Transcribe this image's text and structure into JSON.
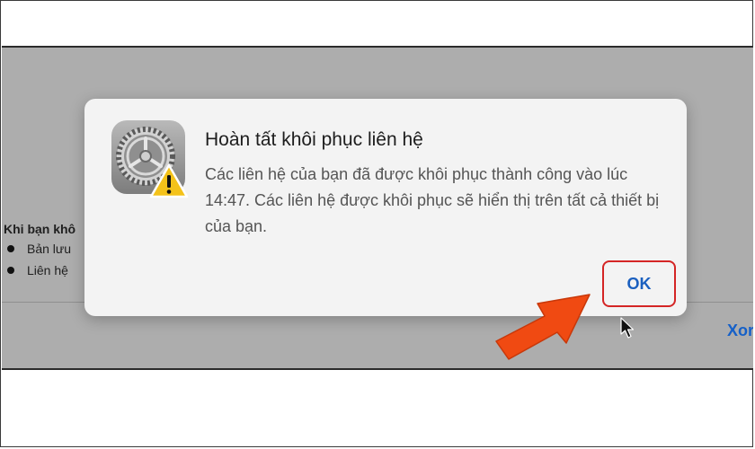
{
  "dialog": {
    "title": "Hoàn tất khôi phục liên hệ",
    "message": "Các liên hệ của bạn đã được khôi phục thành công vào lúc 14:47. Các liên hệ được khôi phục sẽ hiển thị trên tất cả thiết bị của bạn.",
    "ok_label": "OK",
    "icon": "settings-gear-icon",
    "badge_icon": "warning-triangle-icon"
  },
  "background": {
    "heading": "Khi bạn khô",
    "items": [
      {
        "label": "Bản lưu"
      },
      {
        "label": "Liên hệ"
      }
    ],
    "link_label": "Xor"
  },
  "colors": {
    "accent": "#1a5fbf",
    "highlight": "#d42525",
    "arrow": "#f04a12",
    "overlay": "#adadad"
  }
}
